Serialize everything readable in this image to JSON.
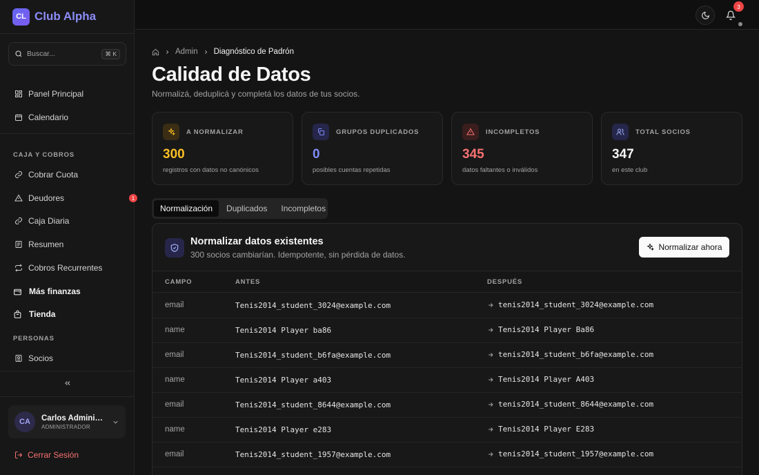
{
  "brand": {
    "initials": "CL",
    "name": "Club Alpha"
  },
  "search": {
    "placeholder": "Buscar...",
    "shortcut": "⌘ K"
  },
  "nav": {
    "top": [
      {
        "label": "Panel Principal",
        "icon": "dashboard-icon"
      },
      {
        "label": "Calendario",
        "icon": "calendar-icon"
      }
    ],
    "section_caja": "CAJA Y COBROS",
    "caja": [
      {
        "label": "Cobrar Cuota",
        "icon": "link-icon"
      },
      {
        "label": "Deudores",
        "icon": "warning-icon",
        "badge": "1"
      },
      {
        "label": "Caja Diaria",
        "icon": "link-icon"
      },
      {
        "label": "Resumen",
        "icon": "receipt-icon"
      },
      {
        "label": "Cobros Recurrentes",
        "icon": "repeat-icon"
      }
    ],
    "groups": [
      {
        "label": "Más finanzas",
        "icon": "wallet-icon"
      },
      {
        "label": "Tienda",
        "icon": "bag-icon"
      }
    ],
    "section_personas": "PERSONAS",
    "personas": [
      {
        "label": "Socios",
        "icon": "id-card-icon"
      }
    ]
  },
  "user": {
    "initials": "CA",
    "name": "Carlos Administrador",
    "role": "ADMINISTRADOR"
  },
  "logout_label": "Cerrar Sesión",
  "topbar": {
    "notification_count": "3"
  },
  "breadcrumb": {
    "parent": "Admin",
    "current": "Diagnóstico de Padrón"
  },
  "page": {
    "title": "Calidad de Datos",
    "subtitle": "Normalizá, deduplicá y completá los datos de tus socios."
  },
  "stats": [
    {
      "label": "A NORMALIZAR",
      "value": "300",
      "desc": "registros con datos no canónicos",
      "color": "#fbbf24",
      "icon": "sparkles-icon"
    },
    {
      "label": "GRUPOS DUPLICADOS",
      "value": "0",
      "desc": "posibles cuentas repetidas",
      "color": "#818cf8",
      "icon": "copy-icon"
    },
    {
      "label": "INCOMPLETOS",
      "value": "345",
      "desc": "datos faltantes o inválidos",
      "color": "#f87171",
      "icon": "alert-icon"
    },
    {
      "label": "TOTAL SOCIOS",
      "value": "347",
      "desc": "en este club",
      "color": "#f5f5f5",
      "icon": "users-icon"
    }
  ],
  "tabs": [
    "Normalización",
    "Duplicados",
    "Incompletos"
  ],
  "panel": {
    "title": "Normalizar datos existentes",
    "subtitle": "300 socios cambiarían. Idempotente, sin pérdida de datos.",
    "action_label": "Normalizar ahora"
  },
  "table": {
    "headers": {
      "field": "CAMPO",
      "before": "ANTES",
      "after": "DESPUÉS"
    },
    "rows": [
      {
        "field": "email",
        "before": "Tenis2014_student_3024@example.com",
        "after": "tenis2014_student_3024@example.com"
      },
      {
        "field": "name",
        "before": "Tenis2014 Player ba86",
        "after": "Tenis2014 Player Ba86"
      },
      {
        "field": "email",
        "before": "Tenis2014_student_b6fa@example.com",
        "after": "tenis2014_student_b6fa@example.com"
      },
      {
        "field": "name",
        "before": "Tenis2014 Player a403",
        "after": "Tenis2014 Player A403"
      },
      {
        "field": "email",
        "before": "Tenis2014_student_8644@example.com",
        "after": "tenis2014_student_8644@example.com"
      },
      {
        "field": "name",
        "before": "Tenis2014 Player e283",
        "after": "Tenis2014 Player E283"
      },
      {
        "field": "email",
        "before": "Tenis2014_student_1957@example.com",
        "after": "tenis2014_student_1957@example.com"
      }
    ]
  }
}
